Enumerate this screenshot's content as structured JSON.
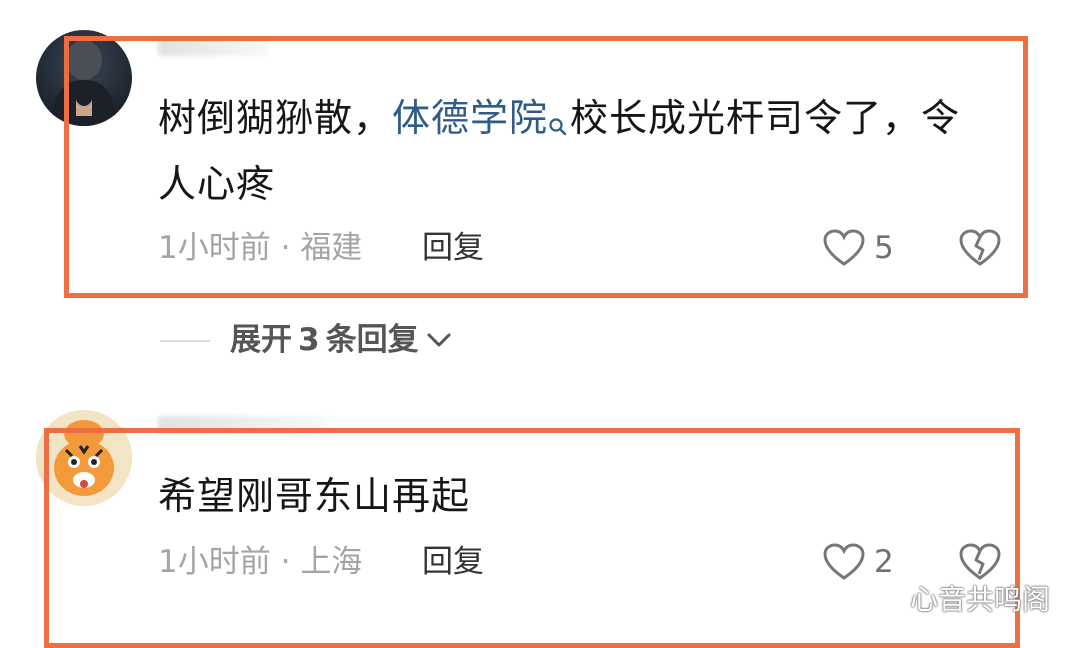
{
  "comments": [
    {
      "text_before": "树倒猢狲散，",
      "topic_link": "体德学院",
      "text_after": "校长成光杆司令了，令",
      "text_line2": "人心疼",
      "time": "1小时前",
      "separator": "·",
      "location": "福建",
      "reply_label": "回复",
      "like_count": "5"
    },
    {
      "text": "希望刚哥东山再起",
      "time": "1小时前",
      "separator": "·",
      "location": "上海",
      "reply_label": "回复",
      "like_count": "2"
    }
  ],
  "expand_replies": {
    "prefix": "展开",
    "count": "3",
    "suffix": "条回复"
  },
  "watermark": "心音共鸣阁",
  "colors": {
    "highlight_border": "#ef6d42",
    "topic_link": "#2d5b8a"
  }
}
